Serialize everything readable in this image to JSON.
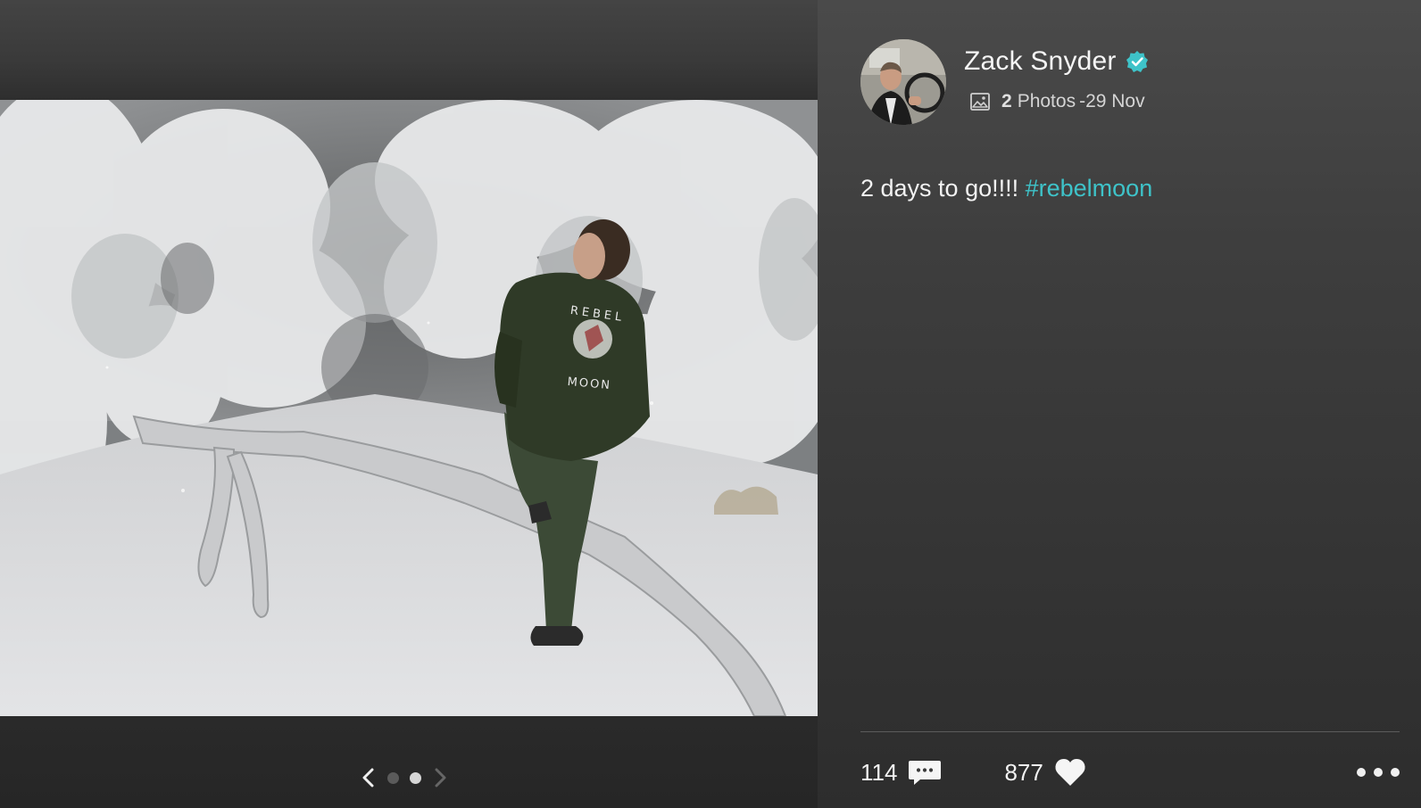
{
  "post": {
    "author_name": "Zack Snyder",
    "verified": true,
    "photo_count": "2",
    "photo_count_label": "Photos",
    "date": "-29 Nov",
    "caption_text": "2 days to go!!!! ",
    "caption_hashtag": "#rebelmoon"
  },
  "photo": {
    "jacket_text_top": "REBEL",
    "jacket_text_bottom": "MOON"
  },
  "carousel": {
    "total": 2,
    "current": 2
  },
  "stats": {
    "comments": "114",
    "likes": "877"
  },
  "colors": {
    "accent": "#3ec3c9",
    "dot_active": "#d6d6d6",
    "dot_inactive": "#5b5b5b"
  },
  "icons": {
    "comment": "speech-bubble-icon",
    "like": "heart-icon",
    "photos": "image-icon",
    "verified": "verified-check-icon",
    "more": "more-dots-icon"
  }
}
